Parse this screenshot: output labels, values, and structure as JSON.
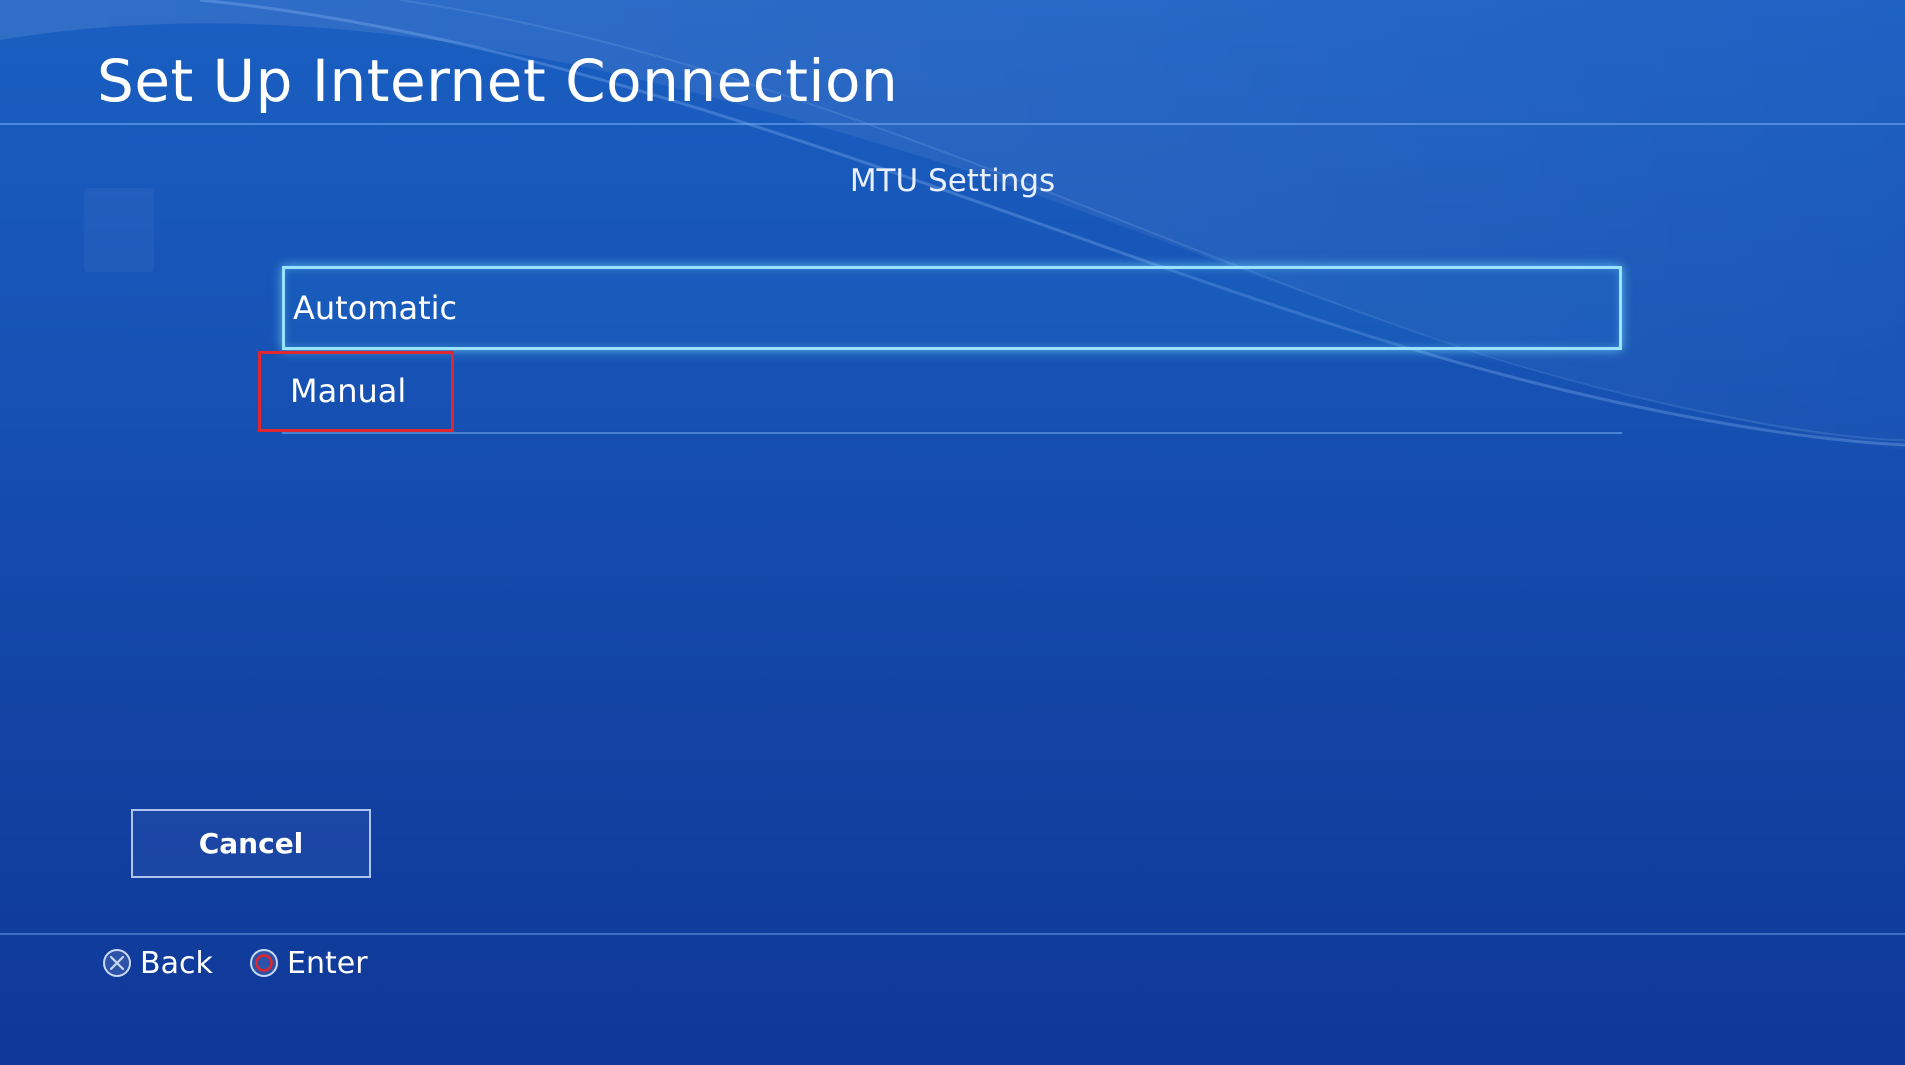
{
  "header": {
    "title": "Set Up Internet Connection"
  },
  "dialog": {
    "subtitle": "MTU Settings",
    "options": [
      {
        "label": "Automatic",
        "focused": true
      },
      {
        "label": "Manual",
        "focused": false
      }
    ],
    "cancel_label": "Cancel"
  },
  "footer": {
    "hints": [
      {
        "icon": "cross-button-icon",
        "label": "Back"
      },
      {
        "icon": "circle-button-icon",
        "label": "Enter"
      }
    ]
  },
  "colors": {
    "background": "#1652b4",
    "focus_border": "#9ae3ff",
    "highlight_box": "#e0262e",
    "circle_icon": "#e0262e"
  }
}
